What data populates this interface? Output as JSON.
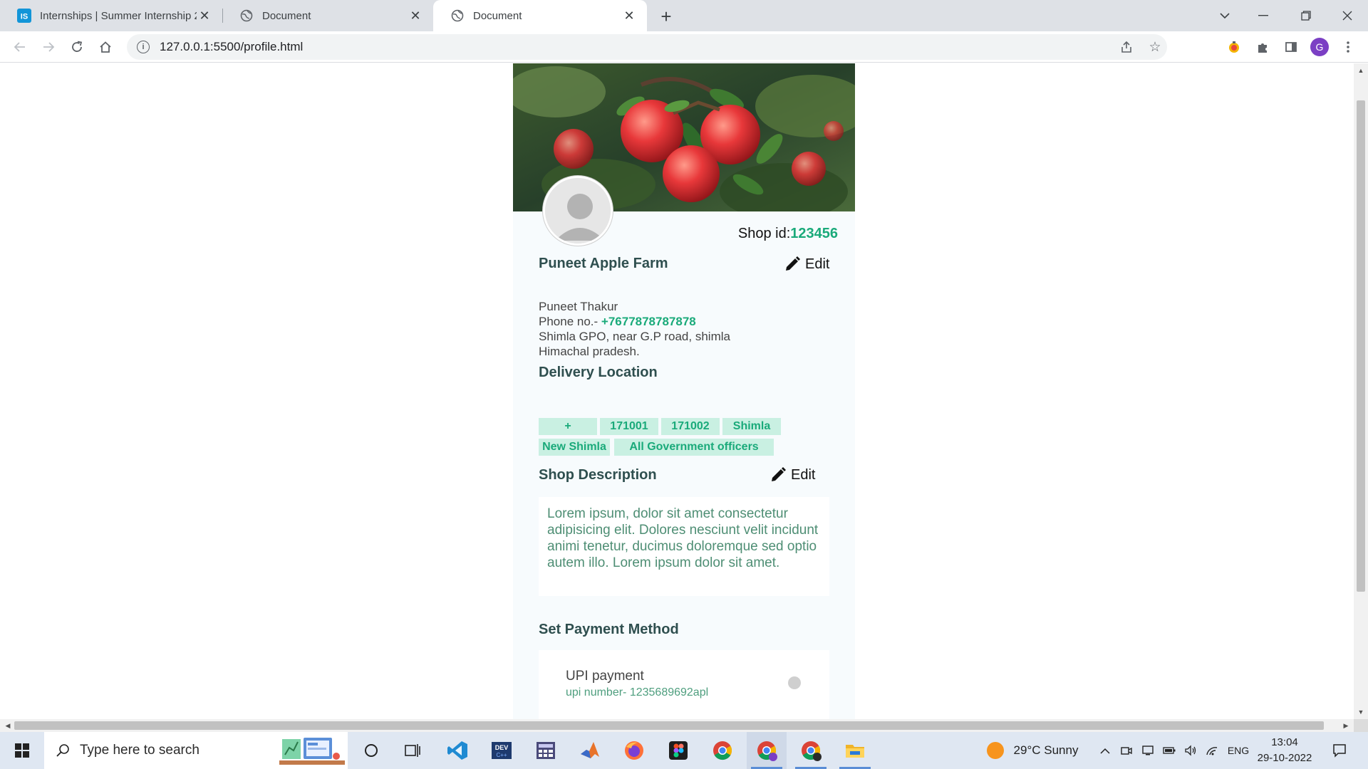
{
  "browser": {
    "tabs": [
      {
        "title": "Internships | Summer Internship 2",
        "favicon": "internshala-icon"
      },
      {
        "title": "Document",
        "favicon": "globe-icon"
      },
      {
        "title": "Document",
        "favicon": "globe-icon"
      }
    ],
    "url": "127.0.0.1:5500/profile.html",
    "profile_initial": "G"
  },
  "page": {
    "shop_id_label": "Shop id:",
    "shop_id_value": "123456",
    "shop_name": "Puneet Apple Farm",
    "edit_label": "Edit",
    "owner_name": "Puneet Thakur",
    "phone_label": "Phone no.- ",
    "phone_value": "+7677878787878",
    "address_line1": "Shimla GPO, near G.P road, shimla",
    "address_line2": "Himachal pradesh.",
    "delivery_title": "Delivery Location",
    "delivery_tags": [
      "+",
      "171001",
      "171002",
      "Shimla",
      "New Shimla",
      "All Government officers"
    ],
    "description_title": "Shop Description",
    "description_text": "Lorem ipsum, dolor sit amet consectetur adipisicing elit. Dolores nesciunt velit incidunt animi tenetur, ducimus doloremque sed optio autem illo. Lorem ipsum dolor sit amet.",
    "payment_title": "Set Payment Method",
    "payment_method": "UPI payment",
    "upi_number": "upi number- 1235689692apl",
    "upi_enabled": false
  },
  "taskbar": {
    "search_placeholder": "Type here to search",
    "weather": "29°C  Sunny",
    "language": "ENG",
    "time": "13:04",
    "date": "29-10-2022"
  },
  "colors": {
    "accent": "#1aaa7a",
    "tag_bg": "#c9f0e2",
    "card_bg": "#f7fbfd"
  }
}
